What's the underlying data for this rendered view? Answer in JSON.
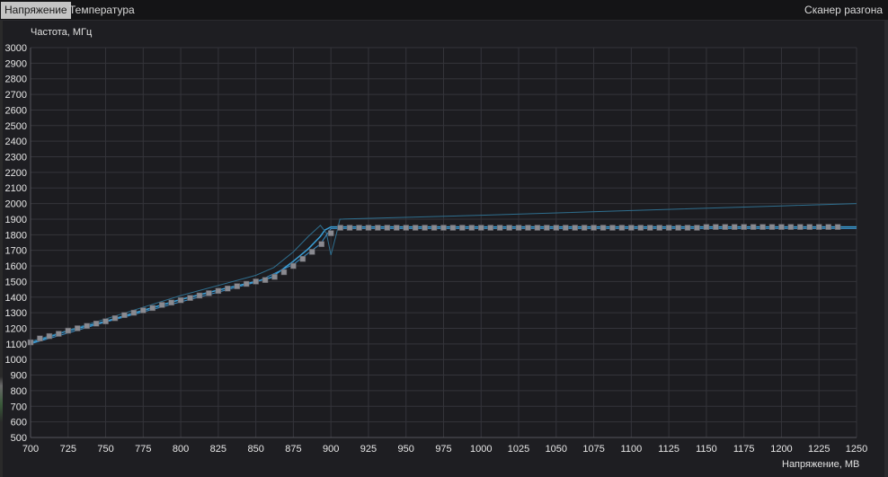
{
  "tabs": [
    {
      "label": "Напряжение",
      "active": true
    },
    {
      "label": "Температура",
      "active": false
    }
  ],
  "scanner_label": "Сканер разгона",
  "chart_data": {
    "type": "line",
    "ylabel": "Частота, МГц",
    "xlabel": "Напряжение, МВ",
    "xlim": [
      700,
      1250
    ],
    "ylim": [
      500,
      3000
    ],
    "xticks": [
      700,
      725,
      750,
      775,
      800,
      825,
      850,
      875,
      900,
      925,
      950,
      975,
      1000,
      1025,
      1050,
      1075,
      1100,
      1125,
      1150,
      1175,
      1200,
      1225,
      1250
    ],
    "yticks": [
      500,
      600,
      700,
      800,
      900,
      1000,
      1100,
      1200,
      1300,
      1400,
      1500,
      1600,
      1700,
      1800,
      1900,
      2000,
      2100,
      2200,
      2300,
      2400,
      2500,
      2600,
      2700,
      2800,
      2900,
      3000
    ],
    "grid": true,
    "colors": {
      "background": "#1e1e22",
      "grid": "#34343a",
      "marker": "#8a8a90",
      "curve": "#3aa0d8",
      "upper": "#2f6f8f",
      "lower": "#3a90c8"
    },
    "series": [
      {
        "kind": "points",
        "x": [
          700,
          706.25,
          712.5,
          718.75,
          725,
          731.25,
          737.5,
          743.75,
          750,
          756.25,
          762.5,
          768.75,
          775,
          781.25,
          787.5,
          793.75,
          800,
          806.25,
          812.5,
          818.75,
          825,
          831.25,
          837.5,
          843.75,
          850,
          856.25,
          862.5,
          868.75,
          875,
          881.25,
          887.5,
          893.75,
          900,
          906.25,
          912.5,
          918.75,
          925,
          931.25,
          937.5,
          943.75,
          950,
          956.25,
          962.5,
          968.75,
          975,
          981.25,
          987.5,
          993.75,
          1000,
          1006.25,
          1012.5,
          1018.75,
          1025,
          1031.25,
          1037.5,
          1043.75,
          1050,
          1056.25,
          1062.5,
          1068.75,
          1075,
          1081.25,
          1087.5,
          1093.75,
          1100,
          1106.25,
          1112.5,
          1118.75,
          1125,
          1131.25,
          1137.5,
          1143.75,
          1150,
          1156.25,
          1162.5,
          1168.75,
          1175,
          1181.25,
          1187.5,
          1193.75,
          1200,
          1206.25,
          1212.5,
          1218.75,
          1225,
          1231.25,
          1237.5
        ],
        "y": [
          1110,
          1135,
          1150,
          1165,
          1185,
          1200,
          1215,
          1230,
          1245,
          1265,
          1285,
          1300,
          1315,
          1330,
          1350,
          1365,
          1380,
          1395,
          1410,
          1425,
          1440,
          1455,
          1470,
          1485,
          1500,
          1510,
          1530,
          1560,
          1600,
          1645,
          1690,
          1740,
          1810,
          1845,
          1845,
          1845,
          1845,
          1845,
          1845,
          1845,
          1845,
          1845,
          1845,
          1845,
          1845,
          1845,
          1845,
          1845,
          1845,
          1845,
          1845,
          1845,
          1845,
          1845,
          1845,
          1845,
          1845,
          1845,
          1845,
          1845,
          1845,
          1845,
          1845,
          1845,
          1845,
          1845,
          1845,
          1845,
          1845,
          1845,
          1845,
          1845,
          1850,
          1850,
          1850,
          1850,
          1850,
          1850,
          1850,
          1850,
          1850,
          1850,
          1850,
          1850,
          1850,
          1850,
          1850
        ]
      },
      {
        "kind": "curve",
        "x": [
          700,
          725,
          750,
          775,
          800,
          825,
          850,
          860,
          868,
          875,
          885,
          893,
          896,
          900,
          905,
          910,
          920,
          1250
        ],
        "y": [
          1105,
          1185,
          1245,
          1315,
          1385,
          1445,
          1500,
          1525,
          1580,
          1630,
          1710,
          1790,
          1830,
          1850,
          1850,
          1850,
          1850,
          1850
        ]
      },
      {
        "kind": "upper",
        "x": [
          700,
          750,
          800,
          850,
          862,
          875,
          885,
          893,
          897,
          900,
          903,
          906,
          1000,
          1100,
          1200,
          1250
        ],
        "y": [
          1115,
          1260,
          1410,
          1540,
          1590,
          1690,
          1790,
          1860,
          1810,
          1670,
          1780,
          1900,
          1925,
          1955,
          1985,
          2000
        ]
      },
      {
        "kind": "lower",
        "x": [
          700,
          750,
          800,
          850,
          875,
          893,
          900,
          950,
          1100,
          1250
        ],
        "y": [
          1100,
          1240,
          1370,
          1495,
          1610,
          1740,
          1840,
          1840,
          1840,
          1840
        ]
      }
    ]
  }
}
